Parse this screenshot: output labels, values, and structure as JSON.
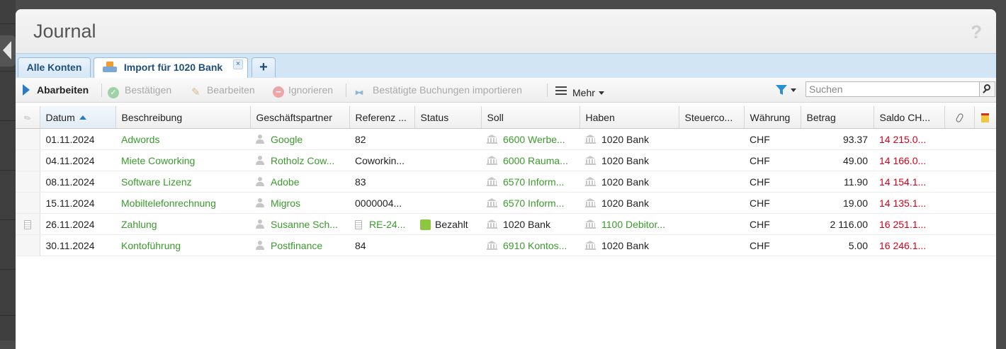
{
  "window": {
    "title": "Journal",
    "help_label": "?"
  },
  "tabs": [
    {
      "label": "Alle Konten",
      "active": false
    },
    {
      "label": "Import für 1020 Bank",
      "active": true,
      "close_label": "×",
      "icon": "inbox-import-icon"
    }
  ],
  "add_tab_label": "+",
  "toolbar": {
    "process_label": "Abarbeiten",
    "confirm_label": "Bestätigen",
    "edit_label": "Bearbeiten",
    "ignore_label": "Ignorieren",
    "import_confirmed_label": "Bestätigte Buchungen importieren",
    "more_label": "Mehr"
  },
  "search": {
    "placeholder": "Suchen",
    "value": ""
  },
  "columns": {
    "date": "Datum",
    "description": "Beschreibung",
    "partner": "Geschäftspartner",
    "reference": "Referenz ...",
    "status": "Status",
    "debit": "Soll",
    "credit": "Haben",
    "tax": "Steuerco...",
    "currency": "Währung",
    "amount": "Betrag",
    "balance": "Saldo CH..."
  },
  "colors": {
    "link_green": "#3a9a2c",
    "negative_red": "#d0021b",
    "status_paid": "#8dc63f",
    "accent_blue": "#2b7bc4"
  },
  "rows": [
    {
      "date": "01.11.2024",
      "description": "Adwords",
      "partner": "Google",
      "reference": "82",
      "reference_is_doc": false,
      "status": "",
      "debit": "6600 Werbe...",
      "debit_linked": true,
      "credit": "1020 Bank",
      "credit_linked": false,
      "tax": "",
      "currency": "CHF",
      "amount": "93.37",
      "balance": "14 215.0...",
      "has_receipt": false
    },
    {
      "date": "04.11.2024",
      "description": "Miete Coworking",
      "partner": "Rotholz Cow...",
      "reference": "Coworkin...",
      "reference_is_doc": false,
      "status": "",
      "debit": "6000 Rauma...",
      "debit_linked": true,
      "credit": "1020 Bank",
      "credit_linked": false,
      "tax": "",
      "currency": "CHF",
      "amount": "49.00",
      "balance": "14 166.0...",
      "has_receipt": false
    },
    {
      "date": "08.11.2024",
      "description": "Software Lizenz",
      "partner": "Adobe",
      "reference": "83",
      "reference_is_doc": false,
      "status": "",
      "debit": "6570 Inform...",
      "debit_linked": true,
      "credit": "1020 Bank",
      "credit_linked": false,
      "tax": "",
      "currency": "CHF",
      "amount": "11.90",
      "balance": "14 154.1...",
      "has_receipt": false
    },
    {
      "date": "15.11.2024",
      "description": "Mobiltelefonrechnung",
      "partner": "Migros",
      "reference": "0000004...",
      "reference_is_doc": false,
      "status": "",
      "debit": "6570 Inform...",
      "debit_linked": true,
      "credit": "1020 Bank",
      "credit_linked": false,
      "tax": "",
      "currency": "CHF",
      "amount": "19.00",
      "balance": "14 135.1...",
      "has_receipt": false
    },
    {
      "date": "26.11.2024",
      "description": "Zahlung",
      "partner": "Susanne Sch...",
      "reference": "RE-24...",
      "reference_is_doc": true,
      "status": "Bezahlt",
      "debit": "1020 Bank",
      "debit_linked": false,
      "credit": "1100 Debitor...",
      "credit_linked": true,
      "tax": "",
      "currency": "CHF",
      "amount": "2 116.00",
      "balance": "16 251.1...",
      "has_receipt": true
    },
    {
      "date": "30.11.2024",
      "description": "Kontoführung",
      "partner": "Postfinance",
      "reference": "84",
      "reference_is_doc": false,
      "status": "",
      "debit": "6910 Kontos...",
      "debit_linked": true,
      "credit": "1020 Bank",
      "credit_linked": false,
      "tax": "",
      "currency": "CHF",
      "amount": "5.00",
      "balance": "16 246.1...",
      "has_receipt": false
    }
  ]
}
